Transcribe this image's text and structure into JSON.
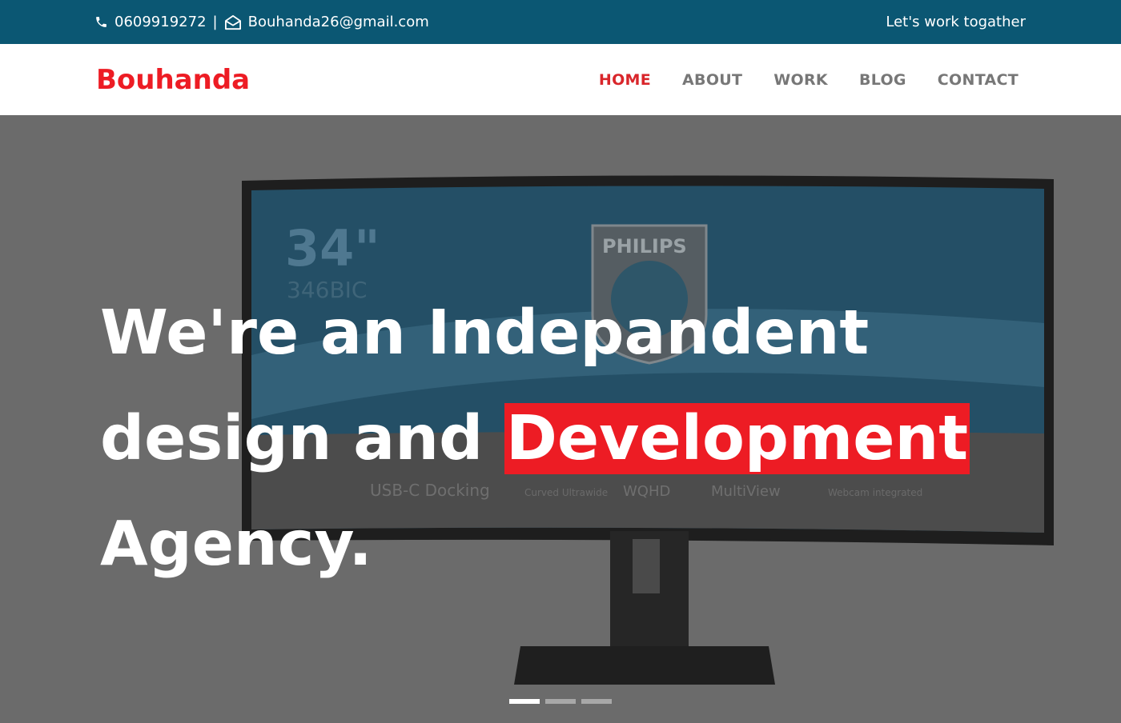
{
  "topbar": {
    "phone": "0609919272",
    "separator": "|",
    "email": "Bouhanda26@gmail.com",
    "tagline": "Let's work togather",
    "icons": [
      "phone-icon",
      "envelope-icon"
    ]
  },
  "nav": {
    "brand": "Bouhanda",
    "items": [
      {
        "label": "HOME",
        "active": true
      },
      {
        "label": "ABOUT",
        "active": false
      },
      {
        "label": "WORK",
        "active": false
      },
      {
        "label": "BLOG",
        "active": false
      },
      {
        "label": "CONTACT",
        "active": false
      }
    ]
  },
  "hero": {
    "line1": "We're an Indepandent",
    "line2_prefix": "design and ",
    "line2_highlight": "Development",
    "line3": "Agency.",
    "background_text": {
      "size": "34\"",
      "model": "346BIC",
      "brand": "PHILIPS",
      "features": [
        "USB-C Docking",
        "Curved Ultrawide",
        "WQHD",
        "MultiView",
        "Webcam integrated"
      ]
    },
    "slides": 3,
    "active_slide": 1
  },
  "colors": {
    "topbar_bg": "#0b5773",
    "brand_red": "#ed1c24",
    "nav_text": "#777777",
    "hero_overlay": "#6a6a6a"
  }
}
